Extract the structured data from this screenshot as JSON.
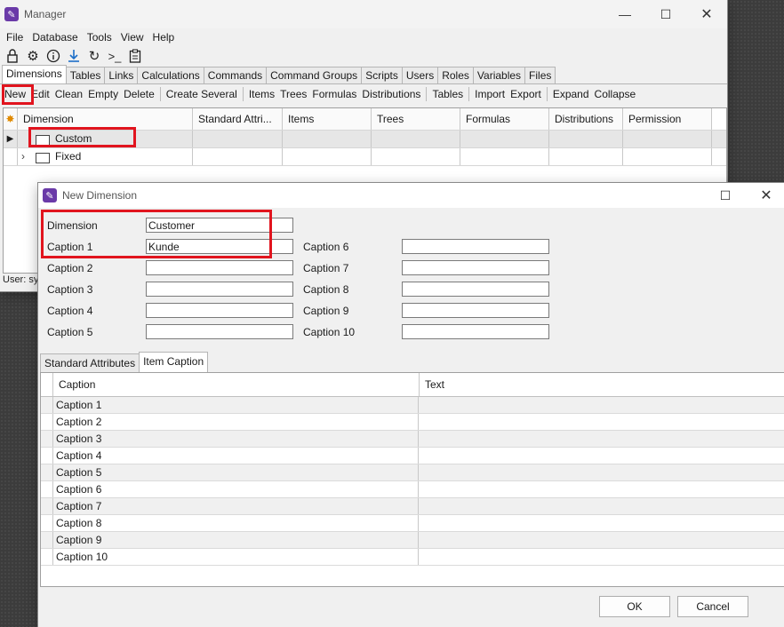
{
  "main": {
    "title": "Manager",
    "menu": [
      "File",
      "Database",
      "Tools",
      "View",
      "Help"
    ],
    "tabs": [
      "Dimensions",
      "Tables",
      "Links",
      "Calculations",
      "Commands",
      "Command Groups",
      "Scripts",
      "Users",
      "Roles",
      "Variables",
      "Files"
    ],
    "commands": {
      "new": "New",
      "edit": "Edit",
      "clean": "Clean",
      "empty": "Empty",
      "delete": "Delete",
      "create_several": "Create Several",
      "items": "Items",
      "trees": "Trees",
      "formulas": "Formulas",
      "distributions": "Distributions",
      "tables": "Tables",
      "import": "Import",
      "export": "Export",
      "expand": "Expand",
      "collapse": "Collapse"
    },
    "columns": [
      "Dimension",
      "Standard Attri...",
      "Items",
      "Trees",
      "Formulas",
      "Distributions",
      "Permission"
    ],
    "rows": [
      {
        "name": "Custom",
        "expand": "▸"
      },
      {
        "name": "Fixed",
        "expand": ">"
      }
    ],
    "status": "User: sy"
  },
  "dialog": {
    "title": "New Dimension",
    "dimension_label": "Dimension",
    "dimension_value": "Customer",
    "captions_left": [
      {
        "label": "Caption 1",
        "value": "Kunde"
      },
      {
        "label": "Caption 2",
        "value": ""
      },
      {
        "label": "Caption 3",
        "value": ""
      },
      {
        "label": "Caption 4",
        "value": ""
      },
      {
        "label": "Caption 5",
        "value": ""
      }
    ],
    "captions_right": [
      {
        "label": "Caption 6",
        "value": ""
      },
      {
        "label": "Caption 7",
        "value": ""
      },
      {
        "label": "Caption 8",
        "value": ""
      },
      {
        "label": "Caption 9",
        "value": ""
      },
      {
        "label": "Caption 10",
        "value": ""
      }
    ],
    "tabs": [
      "Standard Attributes",
      "Item Caption"
    ],
    "grid_headers": [
      "Caption",
      "Text"
    ],
    "grid_rows": [
      "Caption 1",
      "Caption 2",
      "Caption 3",
      "Caption 4",
      "Caption 5",
      "Caption 6",
      "Caption 7",
      "Caption 8",
      "Caption 9",
      "Caption 10"
    ],
    "ok": "OK",
    "cancel": "Cancel"
  },
  "accent_red": "#e1141e",
  "icons": [
    "lock-icon",
    "gear-icon",
    "info-icon",
    "download-icon",
    "refresh-icon",
    "console-icon",
    "clipboard-icon"
  ]
}
